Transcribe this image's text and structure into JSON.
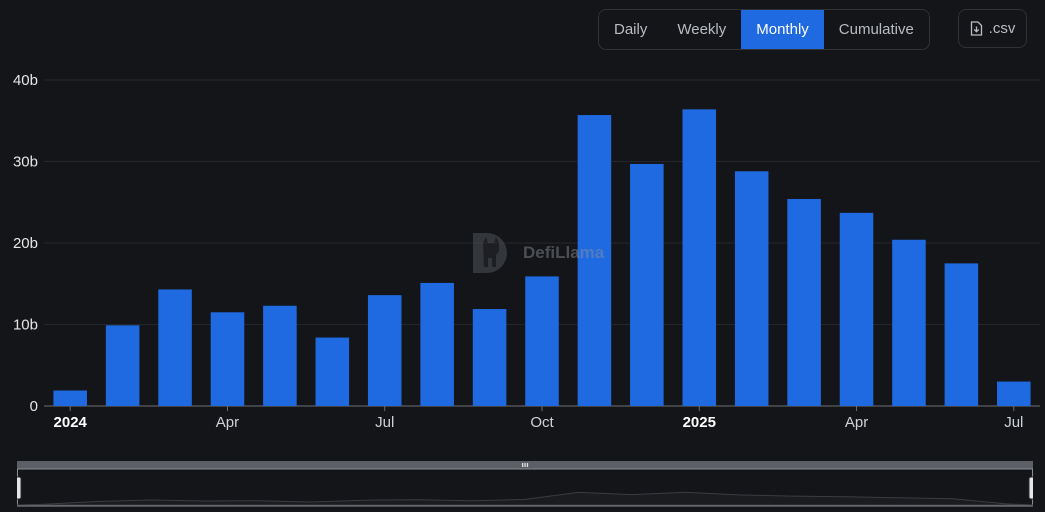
{
  "toolbar": {
    "tabs": [
      {
        "label": "Daily",
        "active": false
      },
      {
        "label": "Weekly",
        "active": false
      },
      {
        "label": "Monthly",
        "active": true
      },
      {
        "label": "Cumulative",
        "active": false
      }
    ],
    "csv_label": ".csv",
    "csv_icon": "file-download-icon"
  },
  "watermark": {
    "text": "DefiLlama",
    "icon": "llama-logo-icon"
  },
  "colors": {
    "bar": "#1f6ae0",
    "background": "#141518",
    "active_tab": "#1f6ae0"
  },
  "chart_data": {
    "type": "bar",
    "title": "",
    "xlabel": "",
    "ylabel": "",
    "ylim": [
      0,
      40
    ],
    "yunit": "b",
    "grid": true,
    "categories": [
      "Jan 2024",
      "Feb 2024",
      "Mar 2024",
      "Apr 2024",
      "May 2024",
      "Jun 2024",
      "Jul 2024",
      "Aug 2024",
      "Sep 2024",
      "Oct 2024",
      "Nov 2024",
      "Dec 2024",
      "Jan 2025",
      "Feb 2025",
      "Mar 2025",
      "Apr 2025",
      "May 2025",
      "Jun 2025",
      "Jul 2025"
    ],
    "values": [
      1.9,
      9.9,
      14.3,
      11.5,
      12.3,
      8.4,
      13.6,
      15.1,
      11.9,
      15.9,
      35.7,
      29.7,
      36.4,
      28.8,
      25.4,
      23.7,
      20.4,
      17.5,
      3.0
    ],
    "yticks": [
      {
        "value": 0,
        "label": "0"
      },
      {
        "value": 10,
        "label": "10b"
      },
      {
        "value": 20,
        "label": "20b"
      },
      {
        "value": 30,
        "label": "30b"
      },
      {
        "value": 40,
        "label": "40b"
      }
    ],
    "xticks": [
      {
        "index": 0,
        "label": "2024",
        "bold": true
      },
      {
        "index": 3,
        "label": "Apr",
        "bold": false
      },
      {
        "index": 6,
        "label": "Jul",
        "bold": false
      },
      {
        "index": 9,
        "label": "Oct",
        "bold": false
      },
      {
        "index": 12,
        "label": "2025",
        "bold": true
      },
      {
        "index": 15,
        "label": "Apr",
        "bold": false
      },
      {
        "index": 18,
        "label": "Jul",
        "bold": false
      }
    ],
    "zoom_range": [
      0,
      1
    ]
  }
}
